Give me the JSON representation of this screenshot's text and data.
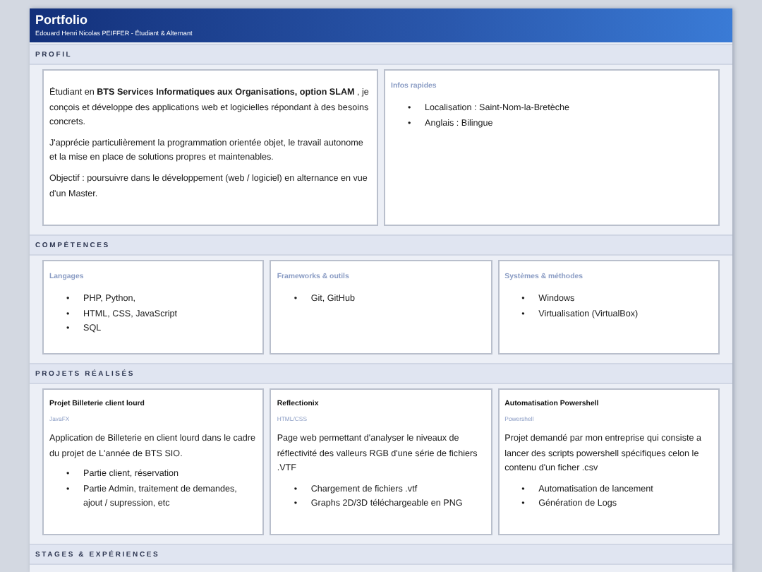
{
  "list_marker": "•",
  "header": {
    "title": "Portfolio",
    "subtitle": "Edouard Henri Nicolas PEIFFER - Étudiant & Alternant"
  },
  "sections": [
    {
      "kind": "profile",
      "heading": "PROFIL",
      "paragraphs": [
        "Étudiant en **BTS Services Informatiques aux Organisations, option SLAM** , je conçois et développe des applications web et logicielles répondant à des besoins concrets.",
        "J'apprécie particulièrement la programmation orientée objet, le travail autonome et la mise en place de solutions propres et maintenables.",
        "Objectif : poursuivre dans le développement (web / logiciel) en alternance en vue d'un Master."
      ],
      "info": {
        "title": "Infos rapides",
        "items": [
          "Localisation : Saint-Nom-la-Bretèche",
          "Anglais : Bilingue"
        ]
      }
    },
    {
      "kind": "skills",
      "heading": "COMPÉTENCES",
      "cards": [
        {
          "title": "Langages",
          "items": [
            "PHP, Python,",
            "HTML, CSS, JavaScript",
            "SQL"
          ]
        },
        {
          "title": "Frameworks & outils",
          "items": [
            "Git, GitHub"
          ]
        },
        {
          "title": "Systèmes & méthodes",
          "items": [
            "Windows",
            "Virtualisation (VirtualBox)"
          ]
        }
      ]
    },
    {
      "kind": "projects",
      "heading": "PROJETS RÉALISÉS",
      "cards": [
        {
          "title": "Projet Billeterie client lourd",
          "tech": "JavaFX",
          "description": "Application de Billeterie en client lourd dans le cadre du projet de L'année de BTS SIO.",
          "items": [
            "Partie client, réservation",
            "Partie Admin, traitement de demandes, ajout / supression, etc"
          ]
        },
        {
          "title": "Reflectionix",
          "tech": "HTML/CSS",
          "description": "Page web permettant d'analyser le niveaux de réflectivité des valleurs RGB d'une série de fichiers .VTF",
          "items": [
            "Chargement de fichiers .vtf",
            "Graphs 2D/3D téléchargeable en PNG"
          ]
        },
        {
          "title": "Automatisation Powershell",
          "tech": "Powershell",
          "description": "Projet demandé par mon entreprise qui consiste a lancer des scripts powershell spécifiques celon le contenu d'un ficher .csv",
          "items": [
            "Automatisation de lancement",
            "Génération de Logs"
          ]
        }
      ]
    },
    {
      "kind": "header-only",
      "heading": "STAGES & EXPÉRIENCES"
    }
  ]
}
